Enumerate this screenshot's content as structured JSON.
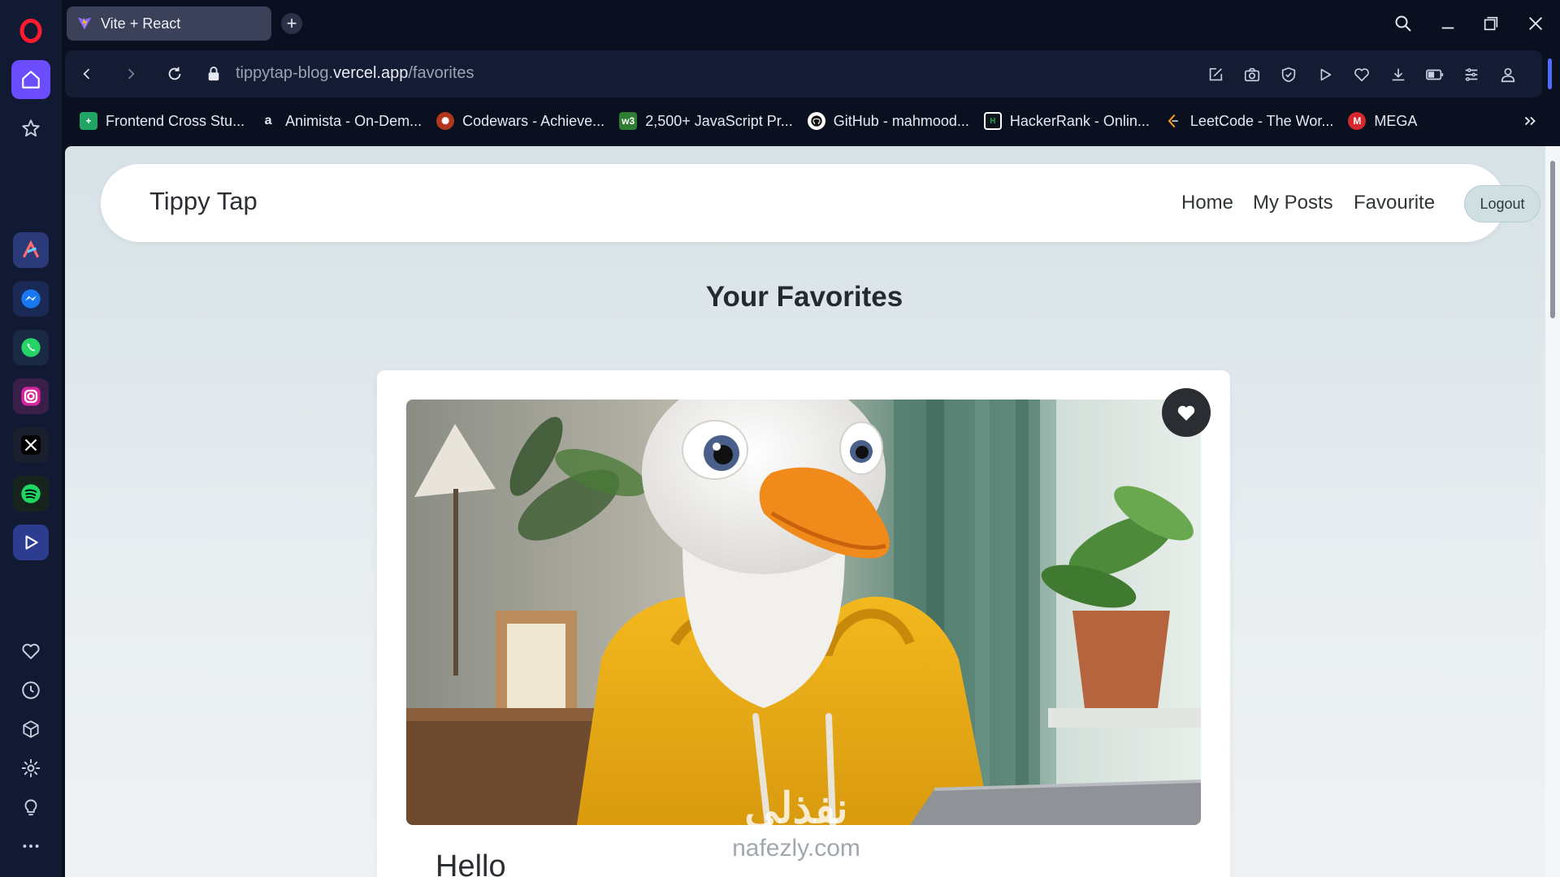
{
  "browser": {
    "tab_title": "Vite + React",
    "url_prefix": "tippytap-blog.",
    "url_domain": "vercel.app",
    "url_path": "/favorites",
    "bookmarks": [
      {
        "label": "Frontend Cross Stu...",
        "icon": "plus-sheet-icon",
        "color": "#1fa463"
      },
      {
        "label": "Animista - On-Dem...",
        "icon": "animista-icon",
        "color": "#1b1b1b"
      },
      {
        "label": "Codewars - Achieve...",
        "icon": "codewars-icon",
        "color": "#b1361e"
      },
      {
        "label": "2,500+ JavaScript Pr...",
        "icon": "w3resource-icon",
        "color": "#2e7d32"
      },
      {
        "label": "GitHub - mahmood...",
        "icon": "github-icon",
        "color": "#ffffff"
      },
      {
        "label": "HackerRank - Onlin...",
        "icon": "hackerrank-icon",
        "color": "#1ba94c"
      },
      {
        "label": "LeetCode - The Wor...",
        "icon": "leetcode-icon",
        "color": "#ffa116"
      },
      {
        "label": "MEGA",
        "icon": "mega-icon",
        "color": "#d9272e"
      }
    ],
    "accent": "#4d6bff"
  },
  "site": {
    "brand": "Tippy Tap",
    "nav": {
      "home": "Home",
      "my_posts": "My Posts",
      "favourite": "Favourite"
    },
    "logout": "Logout",
    "page_title": "Your Favorites",
    "card_title": "Hello",
    "watermark_main": "نفذلي",
    "watermark_sub": "nafezly.com"
  }
}
